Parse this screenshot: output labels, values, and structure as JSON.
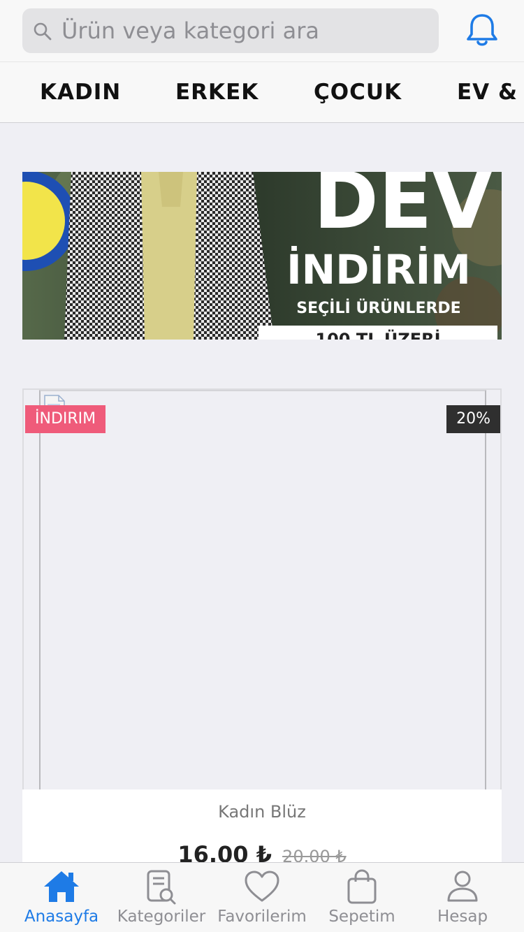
{
  "search": {
    "placeholder": "Ürün veya kategori ara",
    "value": ""
  },
  "header": {
    "notification_icon": "bell-icon"
  },
  "categories": [
    {
      "label": "KADIN"
    },
    {
      "label": "ERKEK"
    },
    {
      "label": "ÇOCUK"
    },
    {
      "label": "EV &"
    }
  ],
  "banner": {
    "title": "DEV",
    "subtitle": "İNDİRİM",
    "line": "SEÇİLİ ÜRÜNLERDE",
    "footer": "100 TL ÜZERİ"
  },
  "product": {
    "badge_sale": "İNDIRIM",
    "badge_discount": "20%",
    "name": "Kadın Blüz",
    "price": "16.00 ₺",
    "old_price": "20.00 ₺"
  },
  "tabbar": {
    "tabs": [
      {
        "label": "Anasayfa",
        "icon": "home-icon",
        "active": true
      },
      {
        "label": "Kategoriler",
        "icon": "catalog-search-icon",
        "active": false
      },
      {
        "label": "Favorilerim",
        "icon": "heart-icon",
        "active": false
      },
      {
        "label": "Sepetim",
        "icon": "bag-icon",
        "active": false
      },
      {
        "label": "Hesap",
        "icon": "user-icon",
        "active": false
      }
    ]
  },
  "colors": {
    "accent": "#1e7be6",
    "sale_badge": "#ef5b7a",
    "discount_badge": "#2f2f2f",
    "background": "#efeff4"
  }
}
